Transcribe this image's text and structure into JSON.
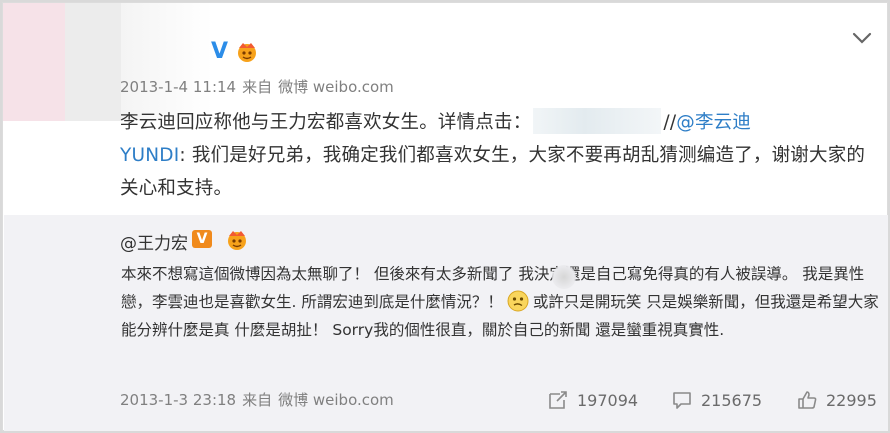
{
  "post": {
    "vip_badge": "V",
    "meta": {
      "time": "2013-1-4 11:14",
      "from_label": "来自",
      "source": "微博 weibo.com"
    },
    "text_before_link": "李云迪回应称他与王力宏都喜欢女生。详情点击：",
    "url_suffix": "//",
    "mention": "@李云迪",
    "mention_cont": "YUNDI",
    "text_after": ": 我们是好兄弟，我确定我们都喜欢女生，大家不要再胡乱猜测编造了，谢谢大家的关心和支持。"
  },
  "repost": {
    "author": "@王力宏",
    "v_badge": "V",
    "text_part1": "本來不想寫這個微博因為太無聊了！ 但後來有太多新聞了 我決定還是自己寫免得真的有人被誤導。 我是異性戀，李雲迪也是喜歡女生. 所謂宏迪到底是什麼情況？！",
    "text_part2": "或許只是開玩笑 只是娛樂新聞，但我還是希望大家能分辨什麼是真 什麼是胡扯！ Sorry我的個性很直，關於自己的新聞 還是蠻重視真實性.",
    "meta": {
      "time": "2013-1-3 23:18",
      "from_label": "来自",
      "source": "微博 weibo.com"
    },
    "stats": {
      "reposts": "197094",
      "comments": "215675",
      "likes": "22995"
    }
  },
  "icons": {
    "crown": "crown-icon",
    "chevron": "chevron-down-icon",
    "repost": "repost-icon",
    "comment": "comment-icon",
    "like": "thumbs-up-icon",
    "emoji": "confused-face-emoji"
  },
  "colors": {
    "link": "#2e7ec7",
    "vip_blue": "#2c8de8",
    "v_orange": "#f08a1c",
    "repost_bg": "#f2f2f5",
    "meta_gray": "#808080"
  }
}
